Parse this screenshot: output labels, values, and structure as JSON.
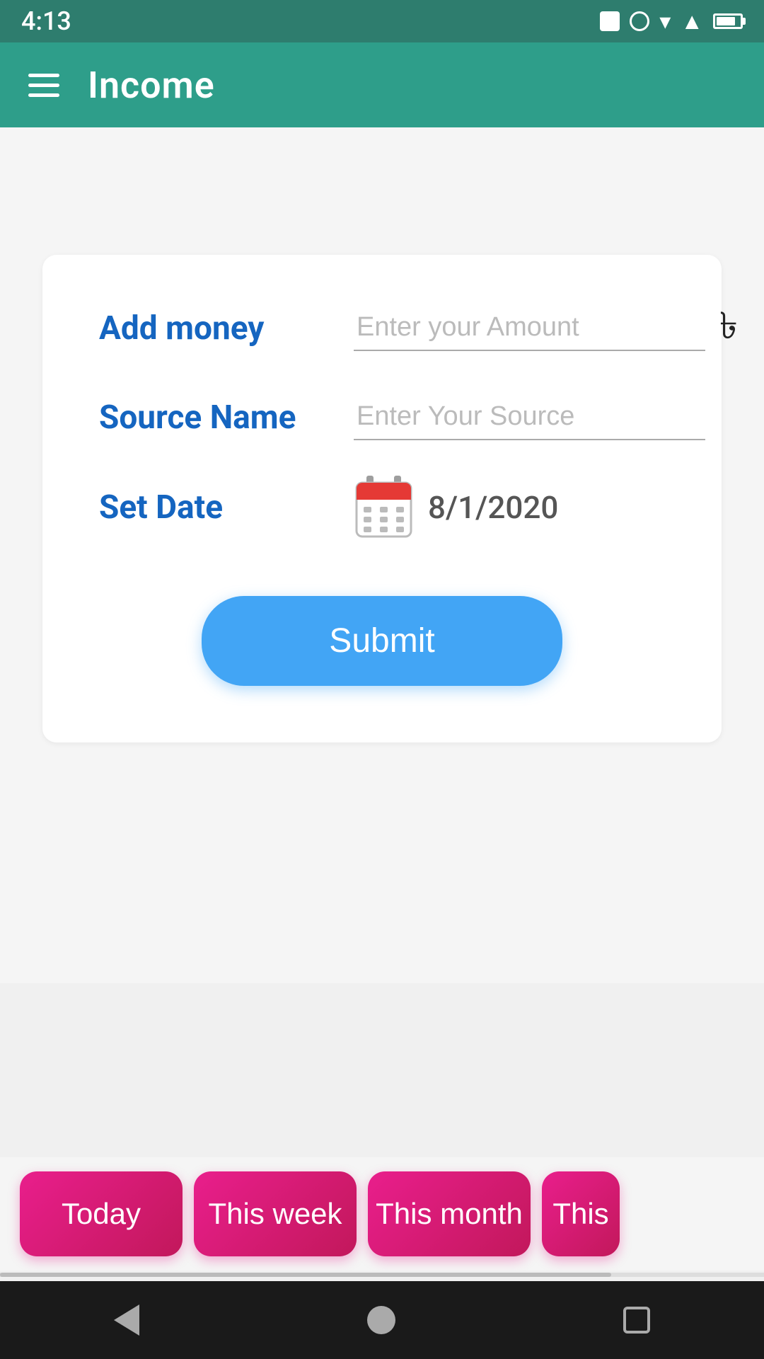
{
  "statusBar": {
    "time": "4:13"
  },
  "appBar": {
    "title": "Income"
  },
  "form": {
    "addMoneyLabel": "Add money",
    "amountPlaceholder": "Enter your Amount",
    "currencySymbol": "৳",
    "sourceLabel": "Source Name",
    "sourcePlaceholder": "Enter Your Source",
    "dateLabel": "Set Date",
    "dateValue": "8/1/2020",
    "submitLabel": "Submit"
  },
  "filters": {
    "buttons": [
      {
        "label": "Today"
      },
      {
        "label": "This week"
      },
      {
        "label": "This month"
      },
      {
        "label": "This"
      }
    ]
  },
  "bottomNav": {
    "back": "back",
    "home": "home",
    "recent": "recent"
  }
}
